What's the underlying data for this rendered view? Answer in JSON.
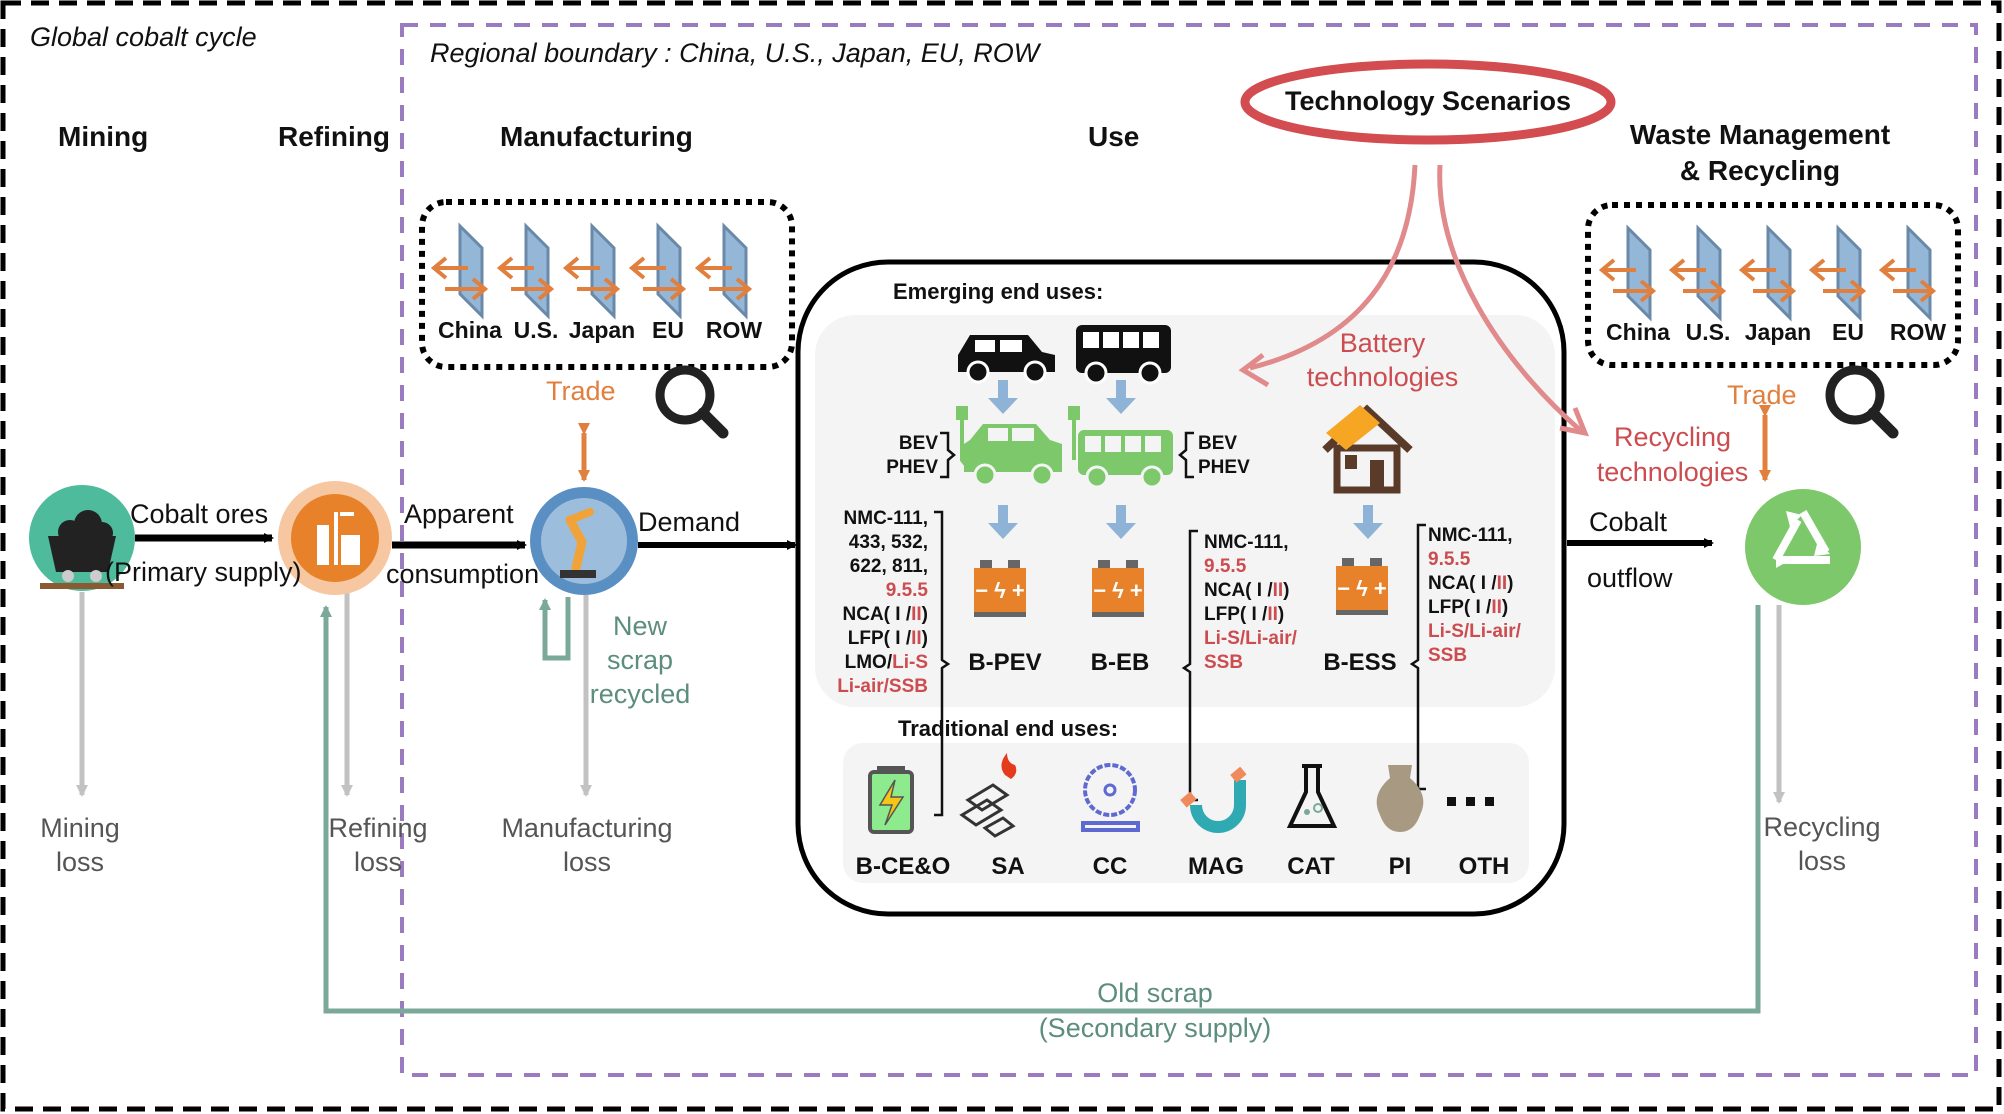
{
  "frame": {
    "outer_label": "Global cobalt cycle",
    "regional_label": "Regional boundary : China, U.S., Japan, EU, ROW"
  },
  "stages": {
    "mining": "Mining",
    "refining": "Refining",
    "manufacturing": "Manufacturing",
    "use": "Use",
    "waste_line1": "Waste  Management",
    "waste_line2": "& Recycling"
  },
  "technology_scenarios": {
    "label": "Technology Scenarios",
    "battery_line1": "Battery",
    "battery_line2": "technologies",
    "recycling_line1": "Recycling",
    "recycling_line2": "technologies"
  },
  "trade_boxes": {
    "regions": [
      "China",
      "U.S.",
      "Japan",
      "EU",
      "ROW"
    ],
    "trade_label": "Trade"
  },
  "flows": {
    "cobalt_ores": "Cobalt ores",
    "primary_supply": "(Primary supply)",
    "apparent": "Apparent",
    "consumption": "consumption",
    "demand": "Demand",
    "cobalt": "Cobalt",
    "outflow": "outflow",
    "new_scrap_line1": "New",
    "new_scrap_line2": "scrap",
    "new_scrap_line3": "recycled",
    "old_scrap_line1": "Old scrap",
    "old_scrap_line2": "(Secondary supply)"
  },
  "losses": {
    "mining": [
      "Mining",
      "loss"
    ],
    "refining": [
      "Refining",
      "loss"
    ],
    "manufacturing": [
      "Manufacturing",
      "loss"
    ],
    "recycling": [
      "Recycling",
      "loss"
    ]
  },
  "use_box": {
    "emerging_title": "Emerging end uses:",
    "traditional_title": "Traditional end uses:",
    "vehicle_types_left": [
      "BEV",
      "PHEV"
    ],
    "vehicle_types_right": [
      "BEV",
      "PHEV"
    ],
    "batteries": [
      "B-PEV",
      "B-EB",
      "B-ESS"
    ],
    "chem_pev": [
      {
        "black": "NMC-111,"
      },
      {
        "black": "433, 532,"
      },
      {
        "black": "622, 811,"
      },
      {
        "red": "9.5.5"
      },
      {
        "black": "NCA( I /",
        "red": "II",
        "black2": ")"
      },
      {
        "black": "LFP( I /",
        "red": "II",
        "black2": ")"
      },
      {
        "black": "LMO/",
        "red": "Li-S"
      },
      {
        "red": "Li-air/SSB"
      }
    ],
    "chem_eb": [
      {
        "black": "NMC-111,"
      },
      {
        "red": "9.5.5"
      },
      {
        "black": "NCA( I /",
        "red": "II",
        "black2": ")"
      },
      {
        "black": "LFP( I /",
        "red": "II",
        "black2": ")"
      },
      {
        "red": "Li-S/Li-air/"
      },
      {
        "red": "SSB"
      }
    ],
    "chem_ess": [
      {
        "black": "NMC-111,"
      },
      {
        "red": "9.5.5"
      },
      {
        "black": "NCA( I /",
        "red": "II",
        "black2": ")"
      },
      {
        "black": "LFP( I /",
        "red": "II",
        "black2": ")"
      },
      {
        "red": "Li-S/Li-air/"
      },
      {
        "red": "SSB"
      }
    ],
    "traditional": [
      "B-CE&O",
      "SA",
      "CC",
      "MAG",
      "CAT",
      "PI",
      "OTH"
    ],
    "more": "• • •"
  },
  "icons": {
    "mining": "mine-cart-icon",
    "refining": "refinery-icon",
    "manufacturing": "robot-arm-icon",
    "recycling": "recycle-icon",
    "magnifier": "magnifier-icon",
    "car": "car-icon",
    "bus": "bus-icon",
    "house": "solar-house-icon",
    "battery": "battery-icon"
  },
  "colors": {
    "purple_boundary": "#9b7bbf",
    "tech_red": "#cc4c50",
    "trade_orange": "#e07f3e",
    "scrap_green": "#7aa99a",
    "loss_gray": "#c2c2c2",
    "ev_green": "#7cc86a",
    "battery_orange": "#e8822a",
    "arrow_blue": "#8fb3d6"
  }
}
